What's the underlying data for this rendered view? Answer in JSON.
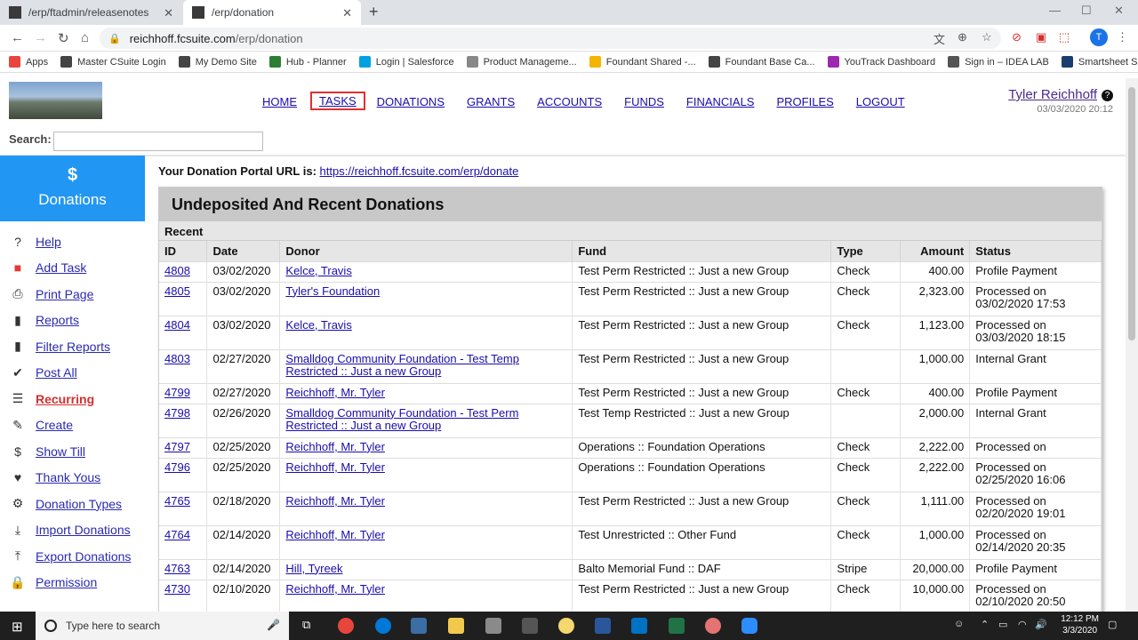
{
  "browser": {
    "tabs": [
      {
        "title": "/erp/ftadmin/releasenotes",
        "active": false
      },
      {
        "title": "/erp/donation",
        "active": true
      }
    ],
    "url_host": "reichhoff.fcsuite.com",
    "url_path": "/erp/donation",
    "profile_initial": "T",
    "bookmarks": [
      {
        "label": "Apps",
        "color": "#e8453c"
      },
      {
        "label": "Master CSuite Login",
        "color": "#444"
      },
      {
        "label": "My Demo Site",
        "color": "#444"
      },
      {
        "label": "Hub - Planner",
        "color": "#2e7d32"
      },
      {
        "label": "Login | Salesforce",
        "color": "#00a1e0"
      },
      {
        "label": "Product Manageme...",
        "color": "#888"
      },
      {
        "label": "Foundant Shared -...",
        "color": "#f4b400"
      },
      {
        "label": "Foundant Base Ca...",
        "color": "#444"
      },
      {
        "label": "YouTrack Dashboard",
        "color": "#9c27b0"
      },
      {
        "label": "Sign in – IDEA LAB",
        "color": "#555"
      },
      {
        "label": "Smartsheet Sign In",
        "color": "#1a3e6e"
      }
    ]
  },
  "header": {
    "nav": [
      "HOME",
      "TASKS",
      "DONATIONS",
      "GRANTS",
      "ACCOUNTS",
      "FUNDS",
      "FINANCIALS",
      "PROFILES",
      "LOGOUT"
    ],
    "user_name": "Tyler Reichhoff",
    "timestamp": "03/03/2020 20:12",
    "search_label": "Search:"
  },
  "sidebar": {
    "icon": "$",
    "title": "Donations",
    "items": [
      {
        "label": "Help",
        "icon": "?"
      },
      {
        "label": "Add Task",
        "icon": "■"
      },
      {
        "label": "Print Page",
        "icon": "⎙"
      },
      {
        "label": "Reports",
        "icon": "▮"
      },
      {
        "label": "Filter Reports",
        "icon": "▮"
      },
      {
        "label": "Post All",
        "icon": "✔"
      },
      {
        "label": "Recurring",
        "icon": "☰"
      },
      {
        "label": "Create",
        "icon": "✎"
      },
      {
        "label": "Show Till",
        "icon": "$"
      },
      {
        "label": "Thank Yous",
        "icon": "♥"
      },
      {
        "label": "Donation Types",
        "icon": "⚙"
      },
      {
        "label": "Import Donations",
        "icon": "⤓"
      },
      {
        "label": "Export Donations",
        "icon": "⤒"
      },
      {
        "label": "Permission",
        "icon": "🔒"
      }
    ]
  },
  "main": {
    "portal_label": "Your Donation Portal URL is:",
    "portal_url": "https://reichhoff.fcsuite.com/erp/donate",
    "panel_title": "Undeposited And Recent Donations",
    "section": "Recent",
    "columns": [
      "ID",
      "Date",
      "Donor",
      "Fund",
      "Type",
      "Amount",
      "Status"
    ],
    "rows": [
      {
        "id": "4808",
        "date": "03/02/2020",
        "donor": "Kelce, Travis",
        "fund": "Test Perm Restricted :: Just a new Group",
        "type": "Check",
        "amount": "400.00",
        "status": "Profile Payment"
      },
      {
        "id": "4805",
        "date": "03/02/2020",
        "donor": "Tyler's Foundation",
        "fund": "Test Perm Restricted :: Just a new Group",
        "type": "Check",
        "amount": "2,323.00",
        "status": "Processed on 03/02/2020 17:53"
      },
      {
        "id": "4804",
        "date": "03/02/2020",
        "donor": "Kelce, Travis",
        "fund": "Test Perm Restricted :: Just a new Group",
        "type": "Check",
        "amount": "1,123.00",
        "status": "Processed on 03/03/2020 18:15"
      },
      {
        "id": "4803",
        "date": "02/27/2020",
        "donor": "Smalldog Community Foundation - Test Temp Restricted :: Just a new Group",
        "fund": "Test Perm Restricted :: Just a new Group",
        "type": "",
        "amount": "1,000.00",
        "status": "Internal Grant"
      },
      {
        "id": "4799",
        "date": "02/27/2020",
        "donor": "Reichhoff, Mr. Tyler",
        "fund": "Test Perm Restricted :: Just a new Group",
        "type": "Check",
        "amount": "400.00",
        "status": "Profile Payment"
      },
      {
        "id": "4798",
        "date": "02/26/2020",
        "donor": "Smalldog Community Foundation - Test Perm Restricted :: Just a new Group",
        "fund": "Test Temp Restricted :: Just a new Group",
        "type": "",
        "amount": "2,000.00",
        "status": "Internal Grant"
      },
      {
        "id": "4797",
        "date": "02/25/2020",
        "donor": "Reichhoff, Mr. Tyler",
        "fund": "Operations :: Foundation Operations",
        "type": "Check",
        "amount": "2,222.00",
        "status": "Processed on"
      },
      {
        "id": "4796",
        "date": "02/25/2020",
        "donor": "Reichhoff, Mr. Tyler",
        "fund": "Operations :: Foundation Operations",
        "type": "Check",
        "amount": "2,222.00",
        "status": "Processed on 02/25/2020 16:06"
      },
      {
        "id": "4765",
        "date": "02/18/2020",
        "donor": "Reichhoff, Mr. Tyler",
        "fund": "Test Perm Restricted :: Just a new Group",
        "type": "Check",
        "amount": "1,111.00",
        "status": "Processed on 02/20/2020 19:01"
      },
      {
        "id": "4764",
        "date": "02/14/2020",
        "donor": "Reichhoff, Mr. Tyler",
        "fund": "Test Unrestricted :: Other Fund",
        "type": "Check",
        "amount": "1,000.00",
        "status": "Processed on 02/14/2020 20:35"
      },
      {
        "id": "4763",
        "date": "02/14/2020",
        "donor": "Hill, Tyreek",
        "fund": "Balto Memorial Fund :: DAF",
        "type": "Stripe",
        "amount": "20,000.00",
        "status": "Profile Payment"
      },
      {
        "id": "4730",
        "date": "02/10/2020",
        "donor": "Reichhoff, Mr. Tyler",
        "fund": "Test Perm Restricted :: Just a new Group",
        "type": "Check",
        "amount": "10,000.00",
        "status": "Processed on 02/10/2020 20:50"
      }
    ]
  },
  "taskbar": {
    "search_placeholder": "Type here to search",
    "time": "12:12 PM",
    "date": "3/3/2020"
  }
}
